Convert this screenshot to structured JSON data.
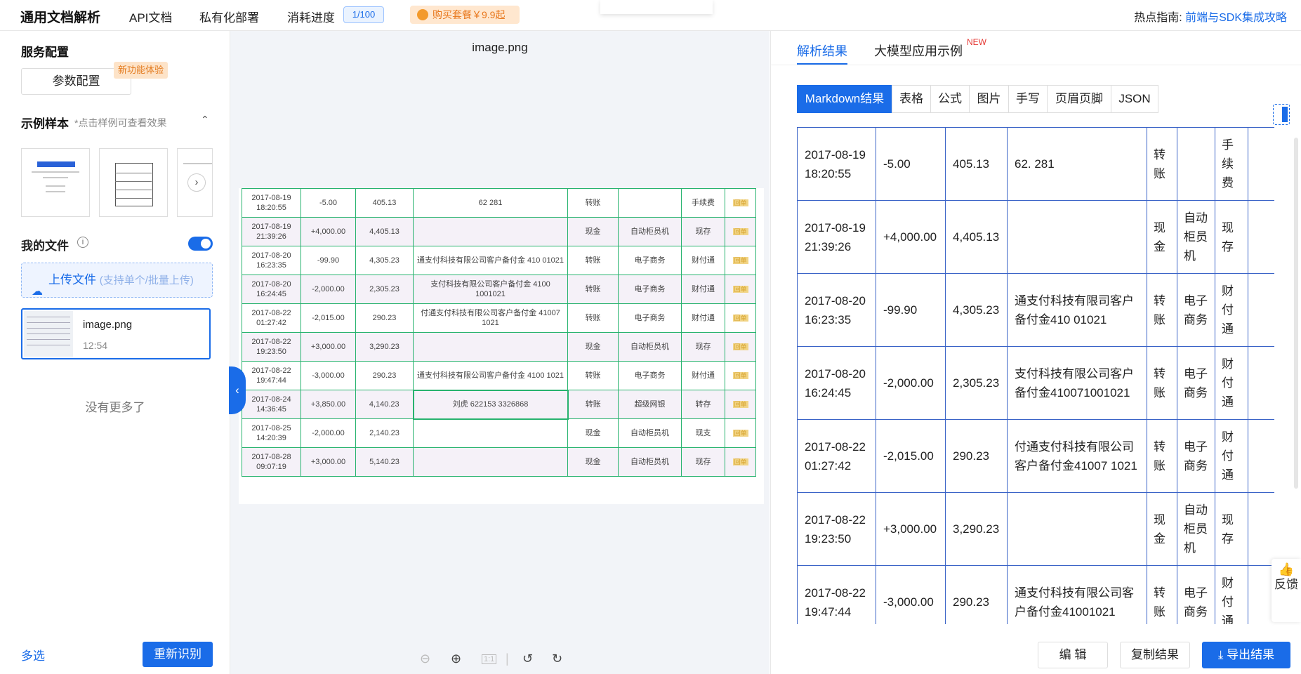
{
  "header": {
    "brand": "通用文档解析",
    "nav": [
      "API文档",
      "私有化部署",
      "消耗进度"
    ],
    "progress": "1/100",
    "buy": "购买套餐￥9.9起",
    "hot_label": "热点指南:",
    "hot_link": "前端与SDK集成攻略"
  },
  "sidebar": {
    "service_config": "服务配置",
    "param_button": "参数配置",
    "new_tag": "新功能体验",
    "samples_title": "示例样本",
    "samples_hint": "*点击样例可查看效果",
    "my_files": "我的文件",
    "upload_label": "上传文件",
    "upload_sub": "(支持单个/批量上传)",
    "file_name": "image.png",
    "file_time": "12:54",
    "no_more": "没有更多了",
    "multi_select": "多选",
    "re_recognize": "重新识别"
  },
  "preview": {
    "title": "image.png",
    "rows": [
      [
        "2017-08-19 18:20:55",
        "-5.00",
        "405.13",
        "62 281",
        "转账",
        "",
        "手续费"
      ],
      [
        "2017-08-19 21:39:26",
        "+4,000.00",
        "4,405.13",
        "",
        "现金",
        "自动柜员机",
        "现存"
      ],
      [
        "2017-08-20 16:23:35",
        "-99.90",
        "4,305.23",
        "通支付科技有限公司客户备付金 410 01021",
        "转账",
        "电子商务",
        "财付通"
      ],
      [
        "2017-08-20 16:24:45",
        "-2,000.00",
        "2,305.23",
        "支付科技有限公司客户备付金 4100 1001021",
        "转账",
        "电子商务",
        "财付通"
      ],
      [
        "2017-08-22 01:27:42",
        "-2,015.00",
        "290.23",
        "付通支付科技有限公司客户备付金 41007 1021",
        "转账",
        "电子商务",
        "财付通"
      ],
      [
        "2017-08-22 19:23:50",
        "+3,000.00",
        "3,290.23",
        "",
        "现金",
        "自动柜员机",
        "现存"
      ],
      [
        "2017-08-22 19:47:44",
        "-3,000.00",
        "290.23",
        "通支付科技有限公司客户备付金 4100 1021",
        "转账",
        "电子商务",
        "财付通"
      ],
      [
        "2017-08-24 14:36:45",
        "+3,850.00",
        "4,140.23",
        "刘虎 622153 3326868",
        "转账",
        "超级网银",
        "转存"
      ],
      [
        "2017-08-25 14:20:39",
        "-2,000.00",
        "2,140.23",
        "",
        "现金",
        "自动柜员机",
        "现支"
      ],
      [
        "2017-08-28 09:07:19",
        "+3,000.00",
        "5,140.23",
        "",
        "现金",
        "自动柜员机",
        "现存"
      ]
    ],
    "stamp": "回单"
  },
  "results": {
    "tab_active": "解析结果",
    "tab_other": "大模型应用示例",
    "new_sup": "NEW",
    "segments": [
      "Markdown结果",
      "表格",
      "公式",
      "图片",
      "手写",
      "页眉页脚",
      "JSON"
    ],
    "rows": [
      [
        "2017-08-19 18:20:55",
        "-5.00",
        "405.13",
        "62. 281",
        "转账",
        "",
        "手续费"
      ],
      [
        "2017-08-19 21:39:26",
        "+4,000.00",
        "4,405.13",
        "",
        "现金",
        "自动柜员机",
        "现存"
      ],
      [
        "2017-08-20 16:23:35",
        "-99.90",
        "4,305.23",
        "通支付科技有限司客户备付金410 01021",
        "转账",
        "电子商务",
        "财付通"
      ],
      [
        "2017-08-20 16:24:45",
        "-2,000.00",
        "2,305.23",
        "支付科技有限公司客户备付金410071001021",
        "转账",
        "电子商务",
        "财付通"
      ],
      [
        "2017-08-22 01:27:42",
        "-2,015.00",
        "290.23",
        "付通支付科技有限公司客户备付金41007 1021",
        "转账",
        "电子商务",
        "财付通"
      ],
      [
        "2017-08-22 19:23:50",
        "+3,000.00",
        "3,290.23",
        "",
        "现金",
        "自动柜员机",
        "现存"
      ],
      [
        "2017-08-22 19:47:44",
        "-3,000.00",
        "290.23",
        "通支付科技有限公司客户备付金41001021",
        "转账",
        "电子商务",
        "财付通"
      ]
    ],
    "feedback": "反馈",
    "edit": "编 辑",
    "copy": "复制结果",
    "export": "导出结果"
  }
}
